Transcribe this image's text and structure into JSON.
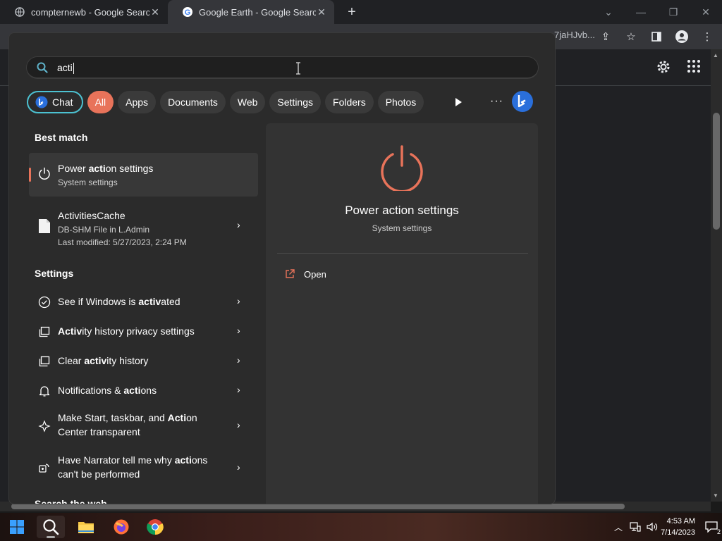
{
  "browser": {
    "tabs": [
      {
        "title": "compternewb - Google Search",
        "active": false
      },
      {
        "title": "Google Earth - Google Search",
        "active": true
      }
    ],
    "new_tab": "+",
    "url_tail": "7jaHJvb...",
    "colors": {
      "chrome_dark": "#202124",
      "chrome_tab": "#35363a"
    }
  },
  "search": {
    "query": "acti",
    "chips": {
      "chat": "Chat",
      "all": "All",
      "apps": "Apps",
      "documents": "Documents",
      "web": "Web",
      "settings": "Settings",
      "folders": "Folders",
      "photos": "Photos"
    },
    "more": "···",
    "accent": "#e8735a",
    "chat_border": "#4cc2d2"
  },
  "best_match": {
    "header": "Best match",
    "items": [
      {
        "title_pre": "Power ",
        "title_bold": "acti",
        "title_post": "on settings",
        "sub": "System settings",
        "icon": "power-icon"
      },
      {
        "title": "ActivitiesCache",
        "sub1": "DB-SHM File in L.Admin",
        "sub2": "Last modified: 5/27/2023, 2:24 PM",
        "icon": "file-icon"
      }
    ]
  },
  "settings_section": {
    "header": "Settings",
    "items": [
      {
        "pre": "See if Windows is ",
        "bold": "activ",
        "post": "ated",
        "icon": "check-circle-icon"
      },
      {
        "pre": "",
        "bold": "Activ",
        "post": "ity history privacy settings",
        "icon": "history-icon"
      },
      {
        "pre": "Clear ",
        "bold": "activ",
        "post": "ity history",
        "icon": "history-icon"
      },
      {
        "pre": "Notifications & ",
        "bold": "acti",
        "post": "ons",
        "icon": "bell-icon"
      },
      {
        "pre": "Make Start, taskbar, and ",
        "bold": "Acti",
        "post": "on",
        "line2": "Center transparent",
        "icon": "sparkle-icon"
      },
      {
        "pre": "Have Narrator tell me why ",
        "bold": "acti",
        "post": "ons",
        "line2": "can't be performed",
        "icon": "narrator-icon"
      }
    ]
  },
  "web_section": {
    "header": "Search the web"
  },
  "preview": {
    "title": "Power action settings",
    "subtitle": "System settings",
    "open_label": "Open",
    "icon": "power-icon"
  },
  "taskbar": {
    "items": [
      "windows-start-icon",
      "search-icon",
      "file-explorer-icon",
      "firefox-icon",
      "chrome-icon"
    ],
    "time": "4:53 AM",
    "date": "7/14/2023",
    "notification_count": "2"
  }
}
